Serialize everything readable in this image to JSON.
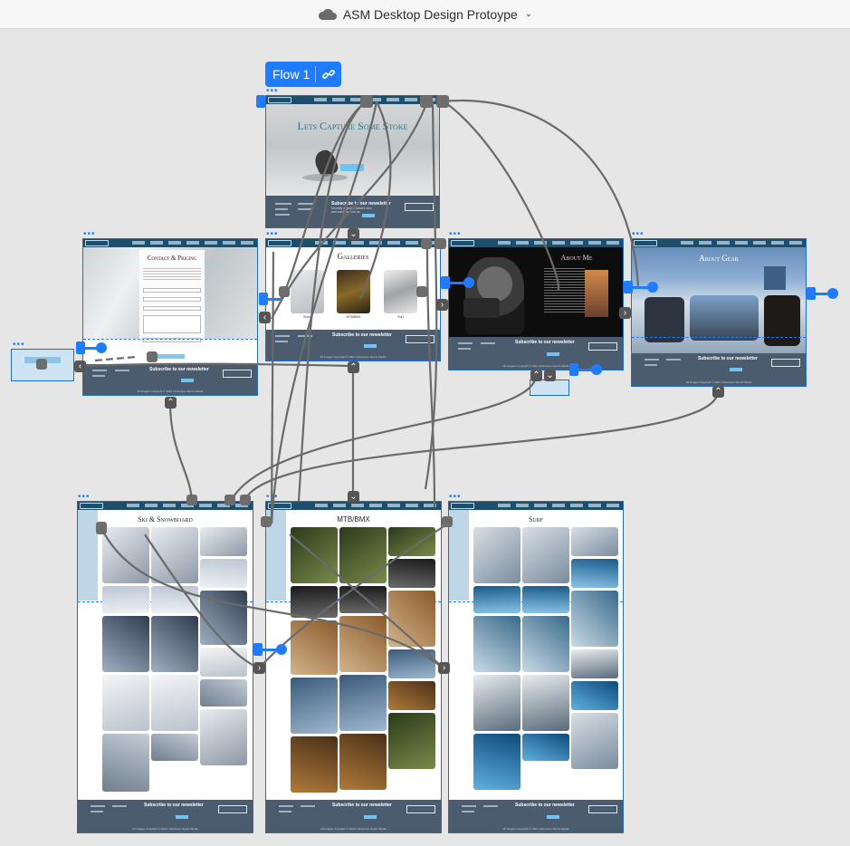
{
  "header": {
    "title": "ASM Desktop Design Protoype",
    "cloud_icon": "cloud-icon",
    "menu_icon": "chevron-down-icon"
  },
  "flow": {
    "label": "Flow 1",
    "link_icon": "link-icon"
  },
  "colors": {
    "canvas": "#e6e6e6",
    "accent": "#1f7bff",
    "wire": "#6d6d6d",
    "nav": "#1f4e6b",
    "footer": "#4b5c6e",
    "button": "#71c3f5"
  },
  "artboards": {
    "home": {
      "hero_title": "Lets Capture Some Stoke",
      "newsletter": "Subscribe to our newsletter",
      "newsletter_sub": "Monthly digest of what's new and exciting from us.",
      "logo": "ADVENTURE"
    },
    "contact": {
      "title": "Contact & Pricing",
      "newsletter": "Subscribe to our newsletter",
      "logo": "ADVENTURE"
    },
    "galleries": {
      "title": "Galleries",
      "items": [
        "Snow",
        "MTB/BMX",
        "Surf"
      ],
      "newsletter": "Subscribe to our newsletter",
      "logo": "ADVENTURE"
    },
    "about_me": {
      "title": "About Me",
      "newsletter": "Subscribe to our newsletter",
      "logo": "ADVENTURE"
    },
    "about_gear": {
      "title": "About Gear",
      "newsletter": "Subscribe to our newsletter",
      "logo": "ADVENTURE"
    },
    "ski": {
      "title": "Ski & Snowboard",
      "newsletter": "Subscribe to our newsletter",
      "logo": "ADVENTURE"
    },
    "mtb": {
      "title": "MTB/BMX",
      "newsletter": "Subscribe to our newsletter",
      "logo": "ADVENTURE"
    },
    "surf": {
      "title": "Surf",
      "newsletter": "Subscribe to our newsletter",
      "logo": "ADVENTURE"
    }
  },
  "footer": {
    "copyright": "All Images Copyright © 2022 | Adventure Sports Media"
  }
}
